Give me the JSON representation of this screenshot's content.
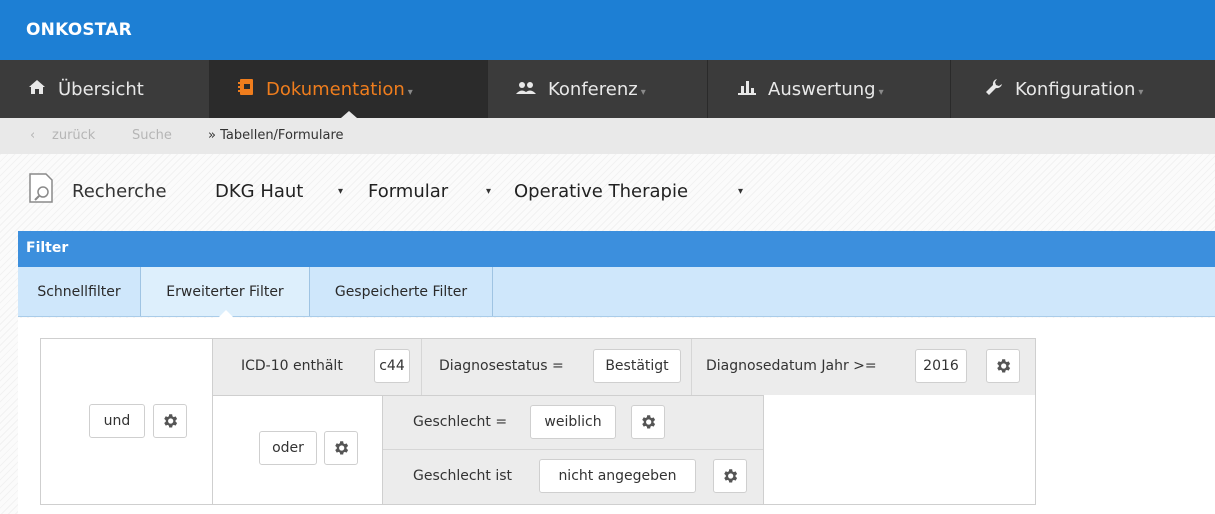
{
  "brand": "ONKOSTAR",
  "colors": {
    "brand_bar": "#1d7fd4",
    "nav_bg": "#3b3b3b",
    "nav_active_text": "#ef7d1d",
    "filter_header": "#3c8fdd",
    "tab_bar": "#cfe7fb"
  },
  "nav": {
    "items": [
      {
        "label": "Übersicht",
        "icon": "home-icon"
      },
      {
        "label": "Dokumentation",
        "icon": "notebook-icon",
        "active": true
      },
      {
        "label": "Konferenz",
        "icon": "people-icon"
      },
      {
        "label": "Auswertung",
        "icon": "bar-chart-icon"
      },
      {
        "label": "Konfiguration",
        "icon": "wrench-icon"
      }
    ]
  },
  "breadcrumb": {
    "back": "zurück",
    "search": "Suche",
    "current": "» Tabellen/Formulare"
  },
  "recherche": {
    "label": "Recherche",
    "selects": [
      "DKG Haut",
      "Formular",
      "Operative Therapie"
    ]
  },
  "filter": {
    "title": "Filter",
    "tabs": [
      "Schnellfilter",
      "Erweiterter Filter",
      "Gespeicherte Filter"
    ],
    "active_tab": "Erweiterter Filter",
    "root_operator": "und",
    "conditions": [
      {
        "label": "ICD-10 enthält",
        "value": "c44"
      },
      {
        "label": "Diagnosestatus =",
        "value": "Bestätigt"
      },
      {
        "label": "Diagnosedatum Jahr >=",
        "value": "2016"
      }
    ],
    "sub_operator": "oder",
    "sub_conditions": [
      {
        "label": "Geschlecht =",
        "value": "weiblich"
      },
      {
        "label": "Geschlecht ist",
        "value": "nicht angegeben"
      }
    ]
  }
}
